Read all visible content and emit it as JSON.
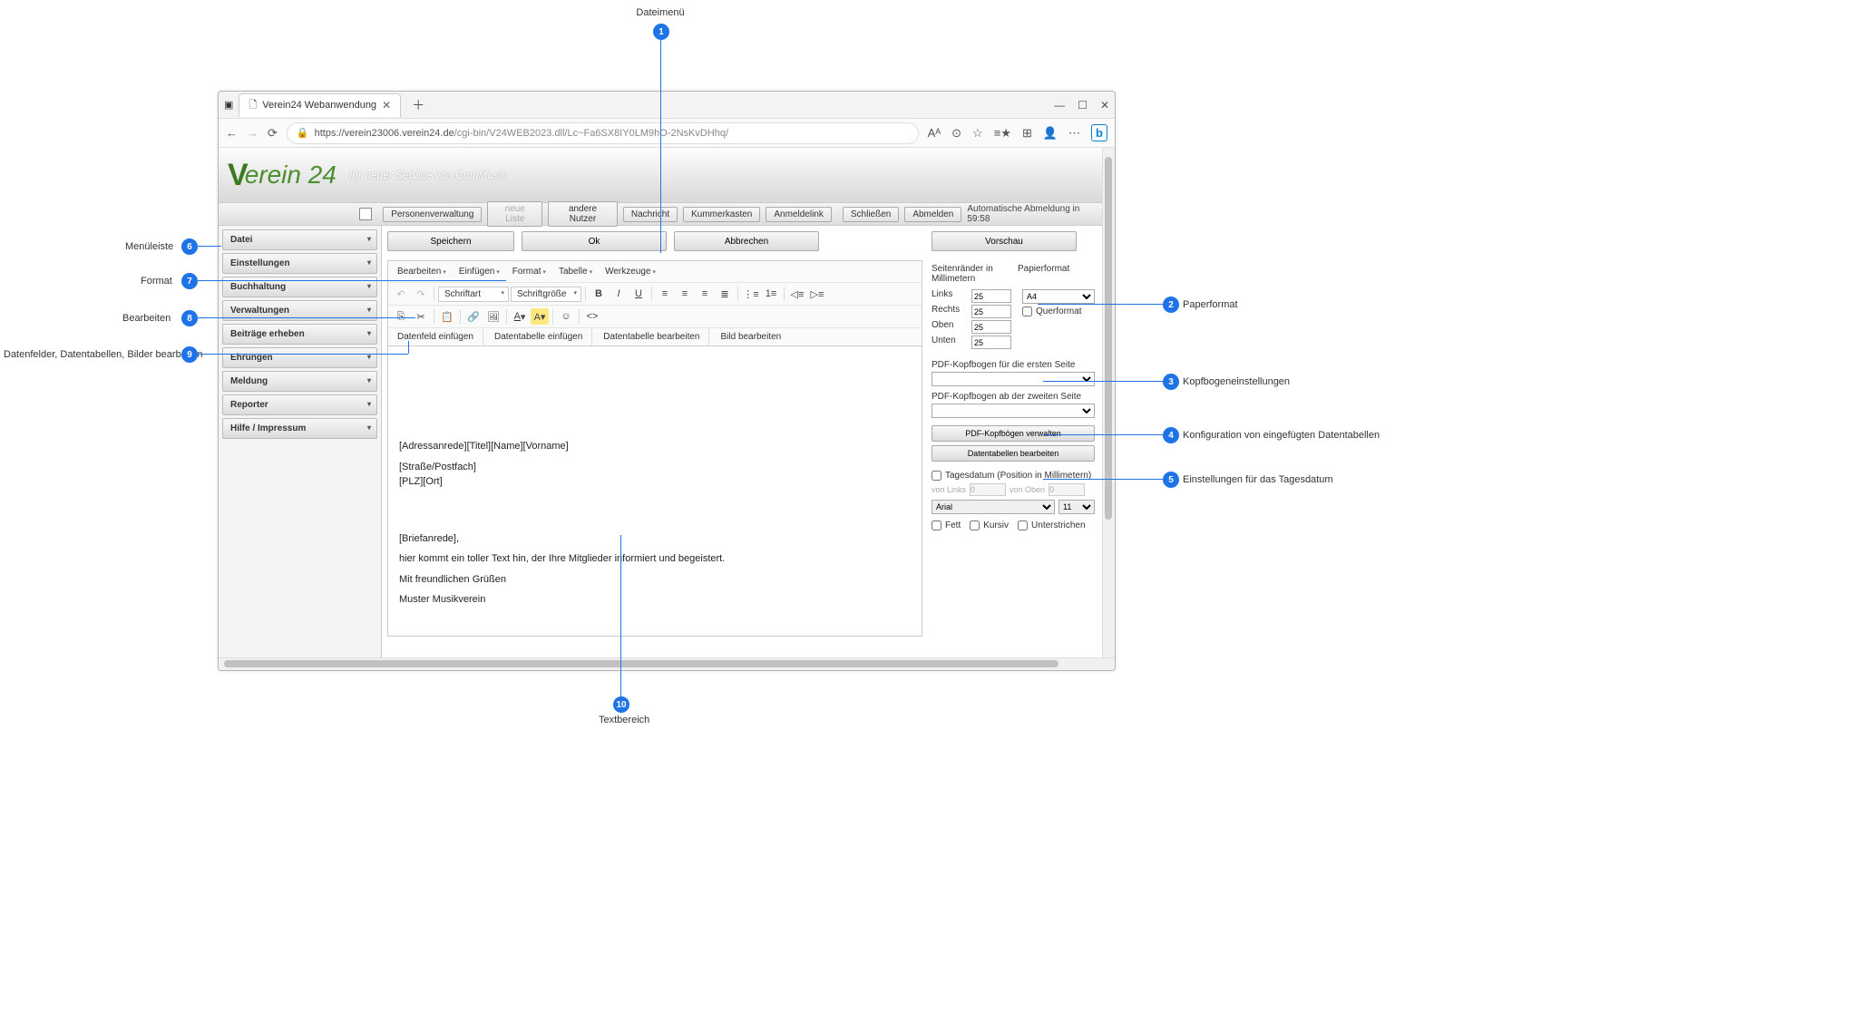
{
  "callouts": {
    "1": "Dateimenü",
    "2": "Paperformat",
    "3": "Kopfbogeneinstellungen",
    "4": "Konfiguration von eingefügten Datentabellen",
    "5": "Einstellungen für das Tagesdatum",
    "6": "Menüleiste",
    "7": "Format",
    "8": "Bearbeiten",
    "9": "Datenfelder, Datentabellen, Bilder bearbeiten",
    "10": "Textbereich"
  },
  "browser": {
    "tab_title": "Verein24 Webanwendung",
    "url_host": "https://verein23006.verein24.de",
    "url_path": "/cgi-bin/V24WEB2023.dll/Lc~Fa6SX8IY0LM9hO-2NsKvDHhq/"
  },
  "logo_text": "erein 24",
  "tagline": "Ihr neuer Service von ComMusic",
  "topbar": {
    "personenverwaltung": "Personenverwaltung",
    "neue_liste": "neue Liste",
    "andere_nutzer": "andere Nutzer",
    "nachricht": "Nachricht",
    "kummerkasten": "Kummerkasten",
    "anmeldelink": "Anmeldelink",
    "schliessen": "Schließen",
    "abmelden": "Abmelden",
    "auto_logout": "Automatische Abmeldung in 59:58"
  },
  "sidebar": [
    "Datei",
    "Einstellungen",
    "Buchhaltung",
    "Verwaltungen",
    "Beiträge erheben",
    "Ehrungen",
    "Meldung",
    "Reporter",
    "Hilfe / Impressum"
  ],
  "actions": {
    "speichern": "Speichern",
    "ok": "Ok",
    "abbrechen": "Abbrechen",
    "vorschau": "Vorschau"
  },
  "tb_menu": {
    "bearbeiten": "Bearbeiten",
    "einfuegen": "Einfügen",
    "format": "Format",
    "tabelle": "Tabelle",
    "werkzeuge": "Werkzeuge"
  },
  "tb_sel": {
    "schriftart": "Schriftart",
    "schriftgroesse": "Schriftgröße"
  },
  "tb_row2": {
    "datenfeld": "Datenfeld einfügen",
    "datentabelle_einf": "Datentabelle einfügen",
    "datentabelle_bearb": "Datentabelle bearbeiten",
    "bild": "Bild bearbeiten"
  },
  "editor": {
    "l1": "[Adressanrede][Titel][Name][Vorname]",
    "l2": "[Straße/Postfach]",
    "l3": "[PLZ][Ort]",
    "l4": "[Briefanrede],",
    "l5": "hier kommt ein toller Text hin, der Ihre Mitglieder informiert und begeistert.",
    "l6": "Mit freundlichen Grüßen",
    "l7": "Muster Musikverein"
  },
  "settings": {
    "seitenraender": "Seitenränder in Millimetern",
    "papierformat_lbl": "Papierformat",
    "links": "Links",
    "rechts": "Rechts",
    "oben": "Oben",
    "unten": "Unten",
    "val": "25",
    "papierformat": "A4",
    "querformat": "Querformat",
    "pdf1": "PDF-Kopfbogen für die ersten Seite",
    "pdf2": "PDF-Kopfbogen ab der zweiten Seite",
    "btn_kopf": "PDF-Kopfbögen verwalten",
    "btn_dt": "Datentabellen bearbeiten",
    "tagesdatum": "Tagesdatum (Position in Millimetern)",
    "von_links": "von Links",
    "von_oben": "von Oben",
    "pos0": "0",
    "font": "Arial",
    "size": "11",
    "fett": "Fett",
    "kursiv": "Kursiv",
    "unter": "Unterstrichen"
  }
}
